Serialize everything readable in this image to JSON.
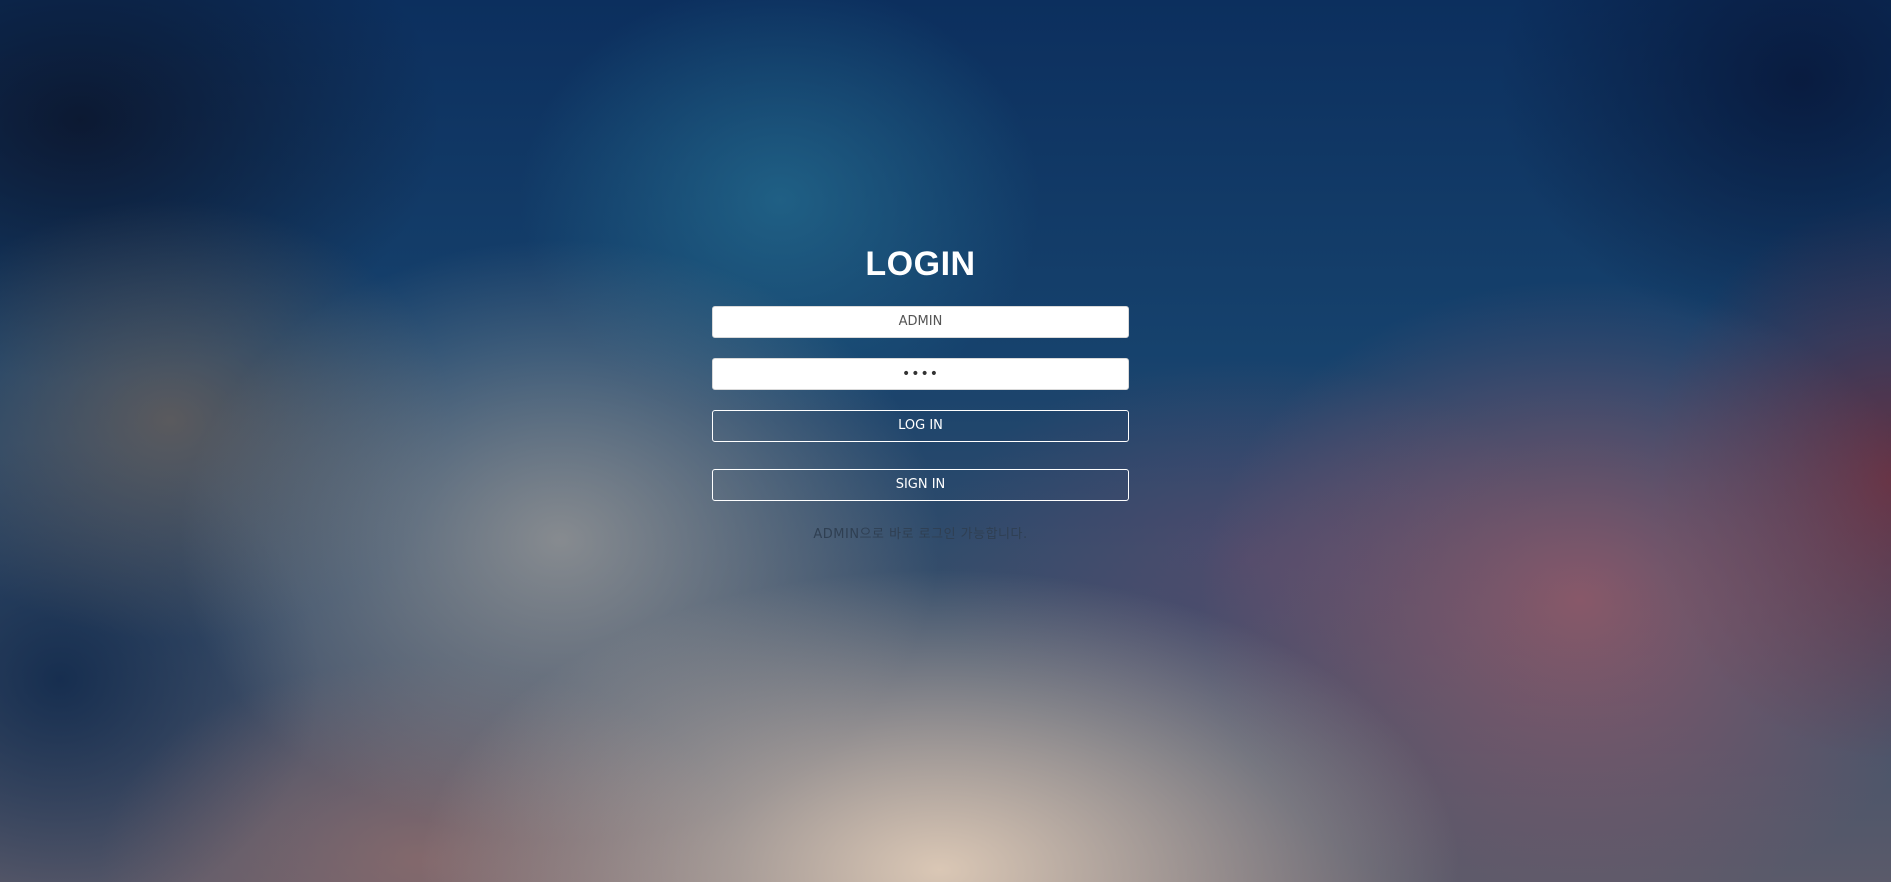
{
  "login": {
    "title": "LOGIN",
    "id_value": "ADMIN",
    "password_value": "••••",
    "login_button_label": "LOG IN",
    "signin_button_label": "SIGN IN",
    "hint_text": "ADMIN으로 바로 로그인 가능합니다."
  }
}
